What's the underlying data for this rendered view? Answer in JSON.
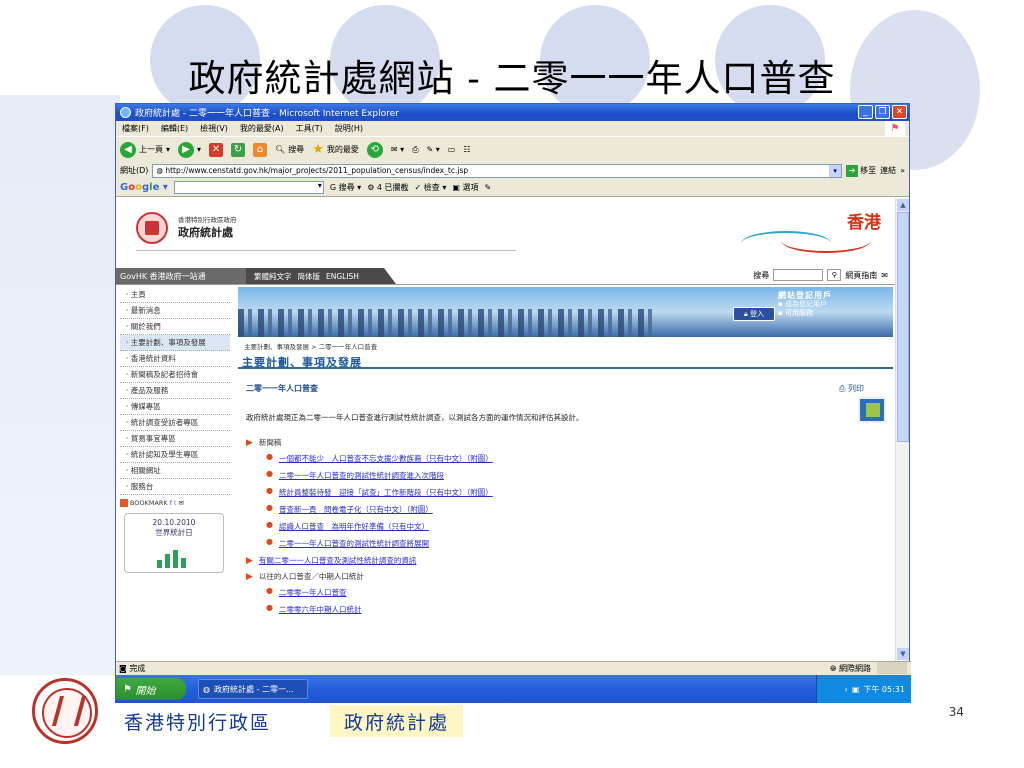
{
  "slide": {
    "title": "政府統計處網站 - 二零一一年人口普查",
    "footer_left": "香港特別行政區",
    "footer_right": "政府統計處",
    "page_number": "34"
  },
  "browser": {
    "window_title": "政府統計處 - 二零一一年人口普查 - Microsoft Internet Explorer",
    "menu": [
      "檔案(F)",
      "編輯(E)",
      "檢視(V)",
      "我的最愛(A)",
      "工具(T)",
      "說明(H)"
    ],
    "toolbar": {
      "back": "上一頁",
      "search": "搜尋",
      "favorites": "我的最愛"
    },
    "address_label": "網址(D)",
    "address_url": "http://www.censtatd.gov.hk/major_projects/2011_population_census/index_tc.jsp",
    "go_label": "移至",
    "links_label": "連結",
    "google": {
      "search_label": "搜尋",
      "blocked": "4 已攔截",
      "check": "檢查",
      "options": "選項"
    },
    "status_text": "完成",
    "zone_text": "網際網路"
  },
  "taskbar": {
    "start": "開始",
    "task_item": "政府統計處 - 二零一...",
    "clock": "下午 05:31"
  },
  "page": {
    "dept_small": "香港特別行政區政府",
    "dept_name": "政府統計處",
    "hk_brand": "香港",
    "govhk": "GovHK 香港政府一站通",
    "lang_links": [
      "繁體純文字",
      "简体版",
      "ENGLISH"
    ],
    "search_label": "搜尋",
    "site_guide": "網頁指南",
    "sidenav": [
      "主頁",
      "最新消息",
      "關於我們",
      "主要計劃、事項及發展",
      "香港統計資料",
      "新聞稿及記者招待會",
      "產品及服務",
      "傳媒專區",
      "統計調查受訪者專區",
      "貿易事宜專區",
      "統計認知及學生專區",
      "相關網址",
      "服務台"
    ],
    "bookmark": "BOOKMARK",
    "event_date": "20.10.2010",
    "event_name": "世界統計日",
    "login": "登入",
    "reg_title": "網站登記用戶",
    "reg_items": [
      "成為登記用戶",
      "可用服務"
    ],
    "breadcrumb": "主要計劃、事項及發展 > 二零一一年人口普查",
    "section_title": "主要計劃、事項及發展",
    "content_title": "二零一一年人口普查",
    "print": "列印",
    "paragraph": "政府統計處現正為二零一一年人口普查進行測試性統計調查，以測試各方面的運作情況和評估其設計。",
    "news_header": "新聞稿",
    "news_items": [
      "一個都不能少　人口普查不忘支援少數族裔（只有中文）（附圖）",
      "二零一一年人口普查的測試性統計調查進入次階段",
      "統計員整裝待發　迎接「試查」工作新階段（只有中文）（附圖）",
      "普查新一頁　問卷電子化（只有中文）（附圖）",
      "認識人口普查　為明年作好準備（只有中文）",
      "二零一一年人口普查的測試性統計調查將展開"
    ],
    "more_info": "有關二零一一人口普查及測試性統計調查的資訊",
    "past_header": "以往的人口普查／中期人口統計",
    "past_items": [
      "二零零一年人口普查",
      "二零零六年中期人口統計"
    ]
  }
}
